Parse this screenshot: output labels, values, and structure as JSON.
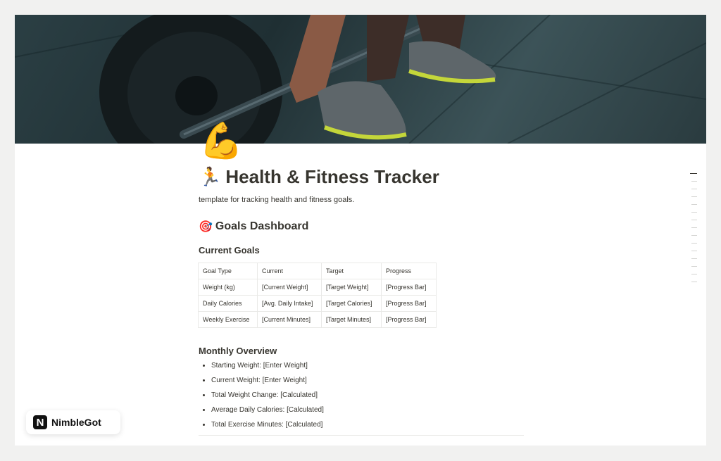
{
  "page": {
    "icon": "flexed-biceps-emoji",
    "title_emoji": "🏃",
    "title": "Health & Fitness Tracker",
    "subtitle": "template for tracking health and fitness goals."
  },
  "dashboard": {
    "emoji": "🎯",
    "heading": "Goals Dashboard"
  },
  "current_goals": {
    "heading": "Current Goals",
    "columns": [
      "Goal Type",
      "Current",
      "Target",
      "Progress"
    ],
    "rows": [
      [
        "Weight (kg)",
        "[Current Weight]",
        "[Target Weight]",
        "[Progress Bar]"
      ],
      [
        "Daily Calories",
        "[Avg. Daily Intake]",
        "[Target Calories]",
        "[Progress Bar]"
      ],
      [
        "Weekly Exercise",
        "[Current Minutes]",
        "[Target Minutes]",
        "[Progress Bar]"
      ]
    ]
  },
  "monthly_overview": {
    "heading": "Monthly Overview",
    "items": [
      "Starting Weight: [Enter Weight]",
      "Current Weight: [Enter Weight]",
      "Total Weight Change: [Calculated]",
      "Average Daily Calories: [Calculated]",
      "Total Exercise Minutes: [Calculated]"
    ]
  },
  "brand": {
    "logo_letter": "N",
    "name": "NimbleGot"
  },
  "colors": {
    "text": "#37352f",
    "border": "#e9e9e7",
    "cover_dark": "#1f2f33",
    "shoe_accent": "#c4d63a"
  }
}
